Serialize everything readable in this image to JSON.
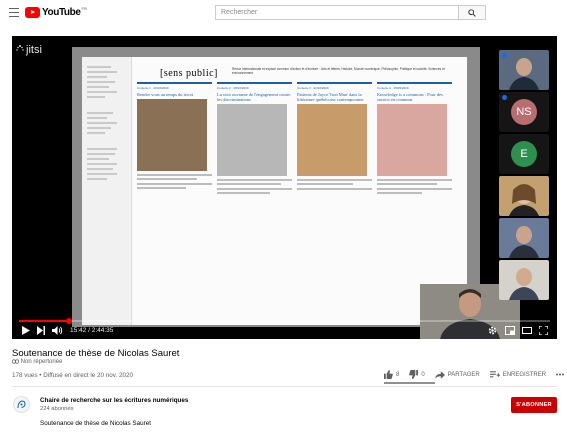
{
  "header": {
    "logo_text": "YouTube",
    "logo_region": "FR",
    "search_placeholder": "Rechercher"
  },
  "player": {
    "conference_brand": "jitsi",
    "shared_site": {
      "brand": "[sens public]",
      "tagline": "Revue internationale et espace commun d'action et d'écriture · Arts et lettres, Histoire, Monde numérique, Philosophie, Politique et société, Sciences et environnement",
      "columns": [
        {
          "kicker": "Contenu 1 · 20/10/2020",
          "title": "Rendre vous au temps du tricot",
          "img_color": "#8a7156"
        },
        {
          "kicker": "Contenu 2 · 08/10/2020",
          "title": "La voix ouvrante de l'engagement contre les discriminations",
          "img_color": "#b7b7b7"
        },
        {
          "kicker": "Contenu 3 · 02/10/2020",
          "title": "Patterns de Joyce 'Iron Man' dans la littérature québécoise contemporaine",
          "img_color": "#c89c6a"
        },
        {
          "kicker": "Contenu 4 · 25/09/2020",
          "title": "Knowledge is a commons : Pour des savoirs en commun",
          "img_color": "#d9a7a0"
        }
      ]
    },
    "participants": [
      {
        "type": "photo",
        "color": "#4a5b74"
      },
      {
        "type": "initials",
        "initials": "NS",
        "color": "#b86d6f"
      },
      {
        "type": "initials",
        "initials": "E",
        "color": "#2f8f4e"
      },
      {
        "type": "photo",
        "color": "#c2a070"
      },
      {
        "type": "photo",
        "color": "#6a7b99"
      },
      {
        "type": "photo",
        "color": "#d5d2cc"
      }
    ],
    "current_time": "15:42",
    "duration": "2:44:35",
    "progress": 0.095
  },
  "video": {
    "title": "Soutenance de thèse de Nicolas Sauret",
    "category": "Non répertoriée",
    "views_line": "178 vues • Diffusé en direct le 20 nov. 2020",
    "likes": "8",
    "dislikes": "0",
    "share_label": "PARTAGER",
    "save_label": "ENREGISTRER",
    "like_ratio": 1.0
  },
  "channel": {
    "name": "Chaire de recherche sur les écritures numériques",
    "subscribers": "224 abonnés",
    "subscribe_label": "S'ABONNER",
    "description": "Soutenance de thèse de Nicolas Sauret"
  },
  "colors": {
    "brand_red": "#ff0000",
    "subscribe_red": "#cc0000",
    "link_blue": "#1d5fa6"
  }
}
